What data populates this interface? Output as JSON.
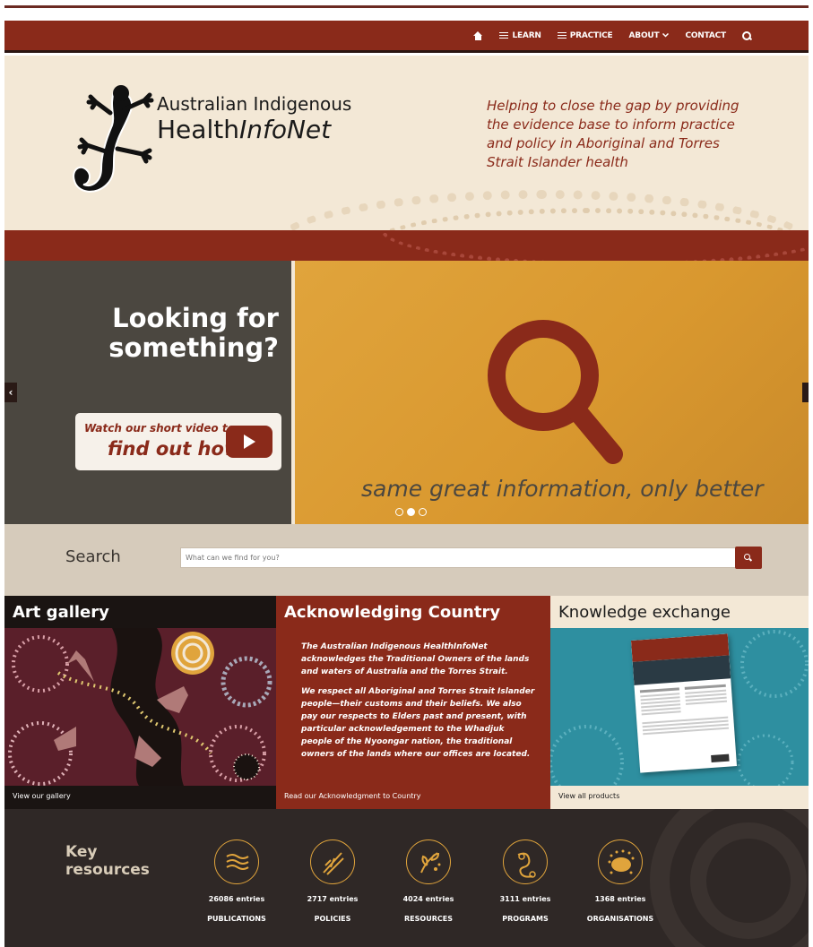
{
  "nav": {
    "items": [
      {
        "label": ""
      },
      {
        "label": "LEARN"
      },
      {
        "label": "PRACTICE"
      },
      {
        "label": "ABOUT"
      },
      {
        "label": "CONTACT"
      }
    ]
  },
  "header": {
    "logo_line1": "Australian Indigenous",
    "logo_line2a": "Health",
    "logo_line2b": "InfoNet",
    "tagline": "Helping to close the gap by providing the evidence base to inform practice and policy in Aboriginal and Torres Strait Islander health"
  },
  "hero": {
    "title": "Looking for something?",
    "video_line1": "Watch our short video to",
    "video_line2": "find out how",
    "caption": "same great information, only better",
    "prev": "‹",
    "active_slide": 2,
    "slide_count": 3
  },
  "search": {
    "label": "Search",
    "placeholder": "What can we find for you?"
  },
  "tiles": {
    "art": {
      "title": "Art gallery",
      "link": "View our gallery"
    },
    "ack": {
      "title": "Acknowledging Country",
      "para1": "The Australian Indigenous HealthInfoNet acknowledges the Traditional Owners of the lands and waters of Australia and the Torres Strait.",
      "para2": "We respect all Aboriginal and Torres Strait Islander people—their customs and their beliefs. We also pay our respects to Elders past and present, with particular acknowledgement to the Whadjuk people of the Nyoongar nation, the traditional owners of the lands where our offices are located.",
      "link": "Read our Acknowledgment to Country"
    },
    "ke": {
      "title": "Knowledge exchange",
      "link": "View all products"
    }
  },
  "key_resources": {
    "title": "Key resources",
    "items": [
      {
        "count": "26086 entries",
        "label": "PUBLICATIONS",
        "icon": "publications-icon"
      },
      {
        "count": "2717 entries",
        "label": "POLICIES",
        "icon": "policies-icon"
      },
      {
        "count": "4024 entries",
        "label": "RESOURCES",
        "icon": "resources-icon"
      },
      {
        "count": "3111 entries",
        "label": "PROGRAMS",
        "icon": "programs-icon"
      },
      {
        "count": "1368 entries",
        "label": "ORGANISATIONS",
        "icon": "organisations-icon"
      }
    ]
  },
  "colors": {
    "brand_red": "#8a2a1a",
    "ochre": "#e0a43c",
    "cream": "#f3e8d6",
    "charcoal": "#2f2826"
  }
}
